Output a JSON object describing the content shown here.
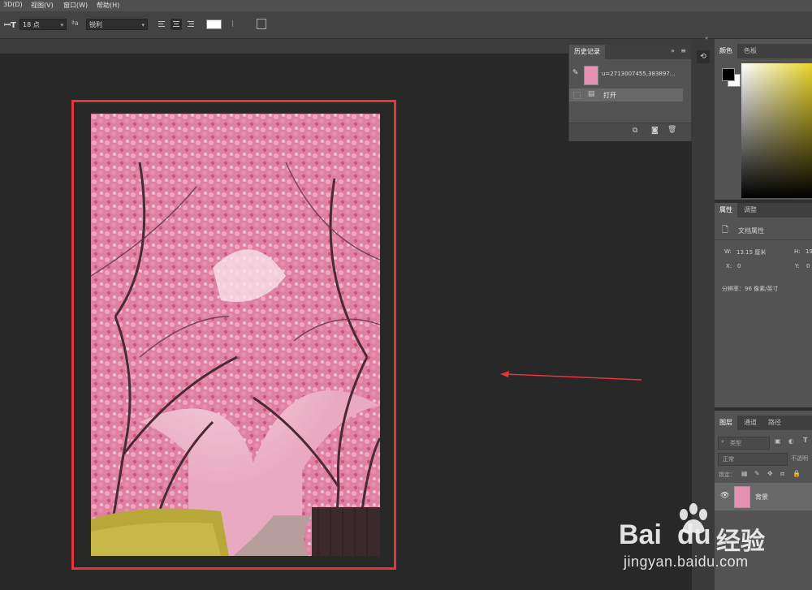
{
  "menu": [
    "3D(D)",
    "视图(V)",
    "窗口(W)",
    "帮助(H)"
  ],
  "options": {
    "font_size": "18 点",
    "antialias": "锐利",
    "text_color": "#ffffff"
  },
  "history_panel": {
    "tab": "历史记录",
    "snapshot": "u=2713007455,383897...",
    "step": "打开"
  },
  "color_panel": {
    "tabs": [
      "颜色",
      "色板"
    ],
    "foreground": "#000000",
    "background": "#ffffff"
  },
  "properties_panel": {
    "tabs": [
      "属性",
      "调整"
    ],
    "doc_label": "文档属性",
    "w_label": "W:",
    "w_value": "13.15 厘米",
    "h_label": "H:",
    "h_value": "19",
    "x_label": "X:",
    "x_value": "0",
    "y_label": "Y:",
    "y_value": "0",
    "resolution": "分辨率：96 像素/英寸"
  },
  "layers_panel": {
    "tabs": [
      "图层",
      "通道",
      "路径"
    ],
    "filter_kind": "类型",
    "blend_mode": "正常",
    "opacity_label": "不透明",
    "lock_label": "锁定：",
    "layer_name": "背景"
  },
  "watermark": {
    "brand": "Bai",
    "brand2": "du",
    "suffix": "经验",
    "url": "jingyan.baidu.com"
  },
  "colors": {
    "highlight": "#e83535",
    "arrow": "#e83535"
  }
}
